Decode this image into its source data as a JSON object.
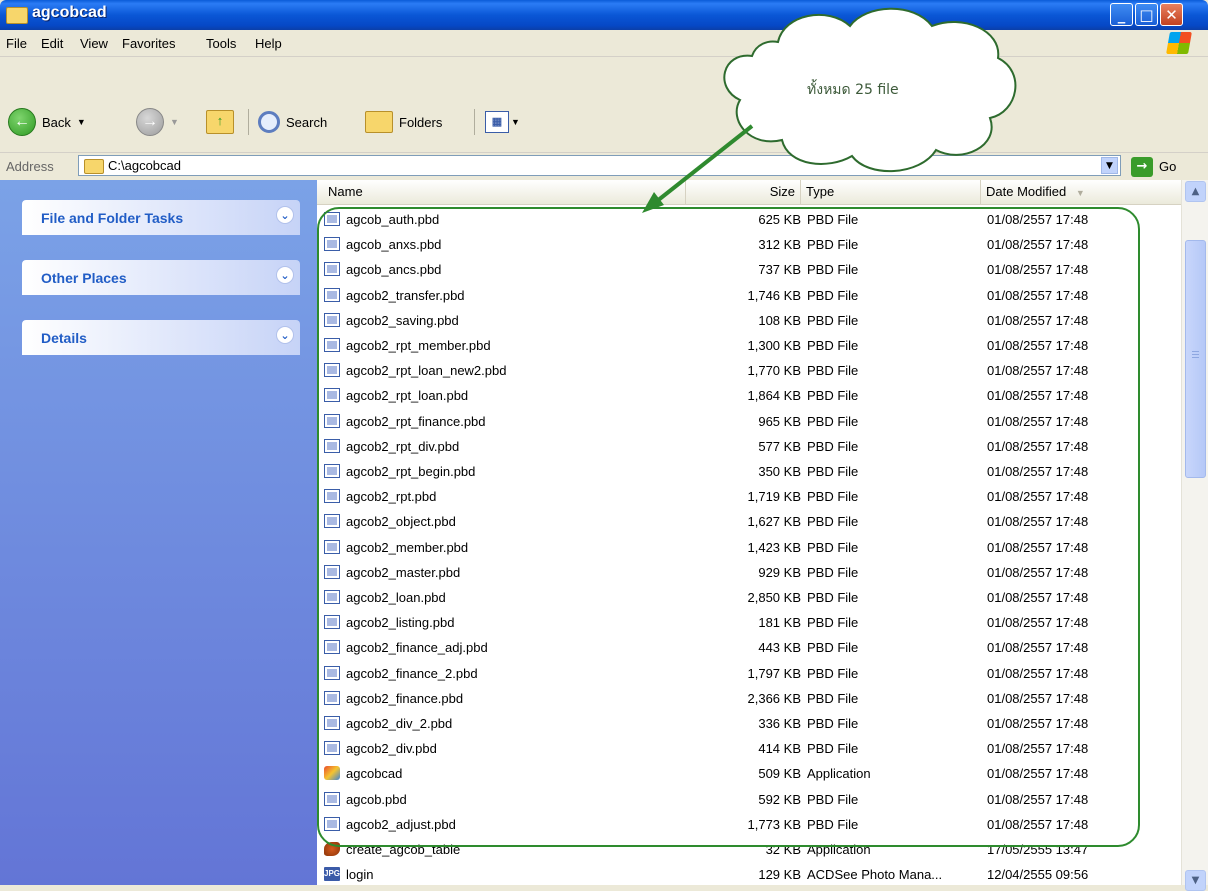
{
  "window": {
    "title": "agcobcad"
  },
  "window_controls": {
    "minimize": "_",
    "maximize": "□",
    "close": "✕"
  },
  "menu": [
    "File",
    "Edit",
    "View",
    "Favorites",
    "Tools",
    "Help"
  ],
  "toolbar": {
    "back": "Back",
    "search": "Search",
    "folders": "Folders"
  },
  "address": {
    "label": "Address",
    "value": "C:\\agcobcad",
    "go": "Go"
  },
  "tasks": {
    "file_folder": "File and Folder Tasks",
    "other_places": "Other Places",
    "details": "Details"
  },
  "columns": {
    "name": "Name",
    "size": "Size",
    "type": "Type",
    "date": "Date Modified"
  },
  "files": [
    {
      "name": "agcob_auth.pbd",
      "size": "625 KB",
      "type": "PBD File",
      "date": "01/08/2557 17:48",
      "icon": "pbd-file-icon"
    },
    {
      "name": "agcob_anxs.pbd",
      "size": "312 KB",
      "type": "PBD File",
      "date": "01/08/2557 17:48",
      "icon": "pbd-file-icon"
    },
    {
      "name": "agcob_ancs.pbd",
      "size": "737 KB",
      "type": "PBD File",
      "date": "01/08/2557 17:48",
      "icon": "pbd-file-icon"
    },
    {
      "name": "agcob2_transfer.pbd",
      "size": "1,746 KB",
      "type": "PBD File",
      "date": "01/08/2557 17:48",
      "icon": "pbd-file-icon"
    },
    {
      "name": "agcob2_saving.pbd",
      "size": "108 KB",
      "type": "PBD File",
      "date": "01/08/2557 17:48",
      "icon": "pbd-file-icon"
    },
    {
      "name": "agcob2_rpt_member.pbd",
      "size": "1,300 KB",
      "type": "PBD File",
      "date": "01/08/2557 17:48",
      "icon": "pbd-file-icon"
    },
    {
      "name": "agcob2_rpt_loan_new2.pbd",
      "size": "1,770 KB",
      "type": "PBD File",
      "date": "01/08/2557 17:48",
      "icon": "pbd-file-icon"
    },
    {
      "name": "agcob2_rpt_loan.pbd",
      "size": "1,864 KB",
      "type": "PBD File",
      "date": "01/08/2557 17:48",
      "icon": "pbd-file-icon"
    },
    {
      "name": "agcob2_rpt_finance.pbd",
      "size": "965 KB",
      "type": "PBD File",
      "date": "01/08/2557 17:48",
      "icon": "pbd-file-icon"
    },
    {
      "name": "agcob2_rpt_div.pbd",
      "size": "577 KB",
      "type": "PBD File",
      "date": "01/08/2557 17:48",
      "icon": "pbd-file-icon"
    },
    {
      "name": "agcob2_rpt_begin.pbd",
      "size": "350 KB",
      "type": "PBD File",
      "date": "01/08/2557 17:48",
      "icon": "pbd-file-icon"
    },
    {
      "name": "agcob2_rpt.pbd",
      "size": "1,719 KB",
      "type": "PBD File",
      "date": "01/08/2557 17:48",
      "icon": "pbd-file-icon"
    },
    {
      "name": "agcob2_object.pbd",
      "size": "1,627 KB",
      "type": "PBD File",
      "date": "01/08/2557 17:48",
      "icon": "pbd-file-icon"
    },
    {
      "name": "agcob2_member.pbd",
      "size": "1,423 KB",
      "type": "PBD File",
      "date": "01/08/2557 17:48",
      "icon": "pbd-file-icon"
    },
    {
      "name": "agcob2_master.pbd",
      "size": "929 KB",
      "type": "PBD File",
      "date": "01/08/2557 17:48",
      "icon": "pbd-file-icon"
    },
    {
      "name": "agcob2_loan.pbd",
      "size": "2,850 KB",
      "type": "PBD File",
      "date": "01/08/2557 17:48",
      "icon": "pbd-file-icon"
    },
    {
      "name": "agcob2_listing.pbd",
      "size": "181 KB",
      "type": "PBD File",
      "date": "01/08/2557 17:48",
      "icon": "pbd-file-icon"
    },
    {
      "name": "agcob2_finance_adj.pbd",
      "size": "443 KB",
      "type": "PBD File",
      "date": "01/08/2557 17:48",
      "icon": "pbd-file-icon"
    },
    {
      "name": "agcob2_finance_2.pbd",
      "size": "1,797 KB",
      "type": "PBD File",
      "date": "01/08/2557 17:48",
      "icon": "pbd-file-icon"
    },
    {
      "name": "agcob2_finance.pbd",
      "size": "2,366 KB",
      "type": "PBD File",
      "date": "01/08/2557 17:48",
      "icon": "pbd-file-icon"
    },
    {
      "name": "agcob2_div_2.pbd",
      "size": "336 KB",
      "type": "PBD File",
      "date": "01/08/2557 17:48",
      "icon": "pbd-file-icon"
    },
    {
      "name": "agcob2_div.pbd",
      "size": "414 KB",
      "type": "PBD File",
      "date": "01/08/2557 17:48",
      "icon": "pbd-file-icon"
    },
    {
      "name": "agcobcad",
      "size": "509 KB",
      "type": "Application",
      "date": "01/08/2557 17:48",
      "icon": "application-icon"
    },
    {
      "name": "agcob.pbd",
      "size": "592 KB",
      "type": "PBD File",
      "date": "01/08/2557 17:48",
      "icon": "pbd-file-icon"
    },
    {
      "name": "agcob2_adjust.pbd",
      "size": "1,773 KB",
      "type": "PBD File",
      "date": "01/08/2557 17:48",
      "icon": "pbd-file-icon"
    },
    {
      "name": "create_agcob_table",
      "size": "32 KB",
      "type": "Application",
      "date": "17/05/2555 13:47",
      "icon": "application-icon"
    },
    {
      "name": "login",
      "size": "129 KB",
      "type": "ACDSee Photo Mana...",
      "date": "12/04/2555 09:56",
      "icon": "jpg-image-icon"
    }
  ],
  "annotation": {
    "text": "ทั้งหมด 25 file"
  }
}
